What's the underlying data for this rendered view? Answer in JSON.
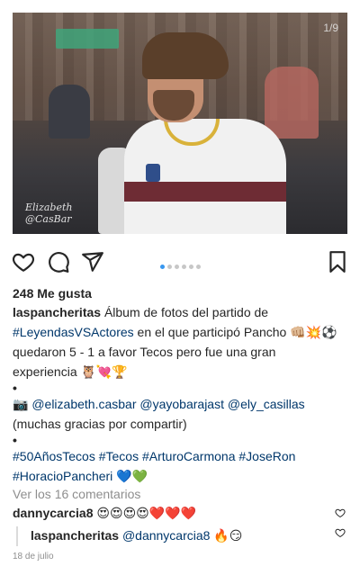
{
  "photo": {
    "counter": "1/9",
    "watermark_line1": "Elizabeth",
    "watermark_line2": "@CasBar"
  },
  "actions": {
    "carousel_total": 6,
    "carousel_active": 1,
    "accent_color": "#3897f0"
  },
  "post": {
    "likes": "248 Me gusta",
    "caption_user": "laspancheritas",
    "caption_line1": " Álbum de fotos del partido de",
    "caption_tag1": "#LeyendasVSActores",
    "caption_line2": " en el que participó Pancho 👊🏼💥⚽",
    "caption_line3": "quedaron  5 - 1 a favor Tecos pero fue una gran",
    "caption_line4": "experiencia 🦉💘🏆",
    "bullet": "•",
    "credit_camera": "📷 ",
    "mention1": "@elizabeth.casbar",
    "mention2": "@yayobarajast",
    "mention3": "@ely_casillas",
    "thanks": "(muchas gracias por compartir)",
    "hashtags_line1": [
      "#50AñosTecos",
      "#Tecos",
      "#ArturoCarmona",
      "#JoseRon"
    ],
    "hashtag_last": "#HoracioPancheri",
    "hearts": " 💙💚"
  },
  "comments": {
    "view_all": "Ver los 16 comentarios",
    "comment1_user": "dannycarcia8",
    "comment1_text": " 😍😍😍😍❤️❤️❤️",
    "reply_user": "laspancheritas",
    "reply_mention": "@dannycarcia8",
    "reply_text": " 🔥😏"
  },
  "date": "18 de julio"
}
